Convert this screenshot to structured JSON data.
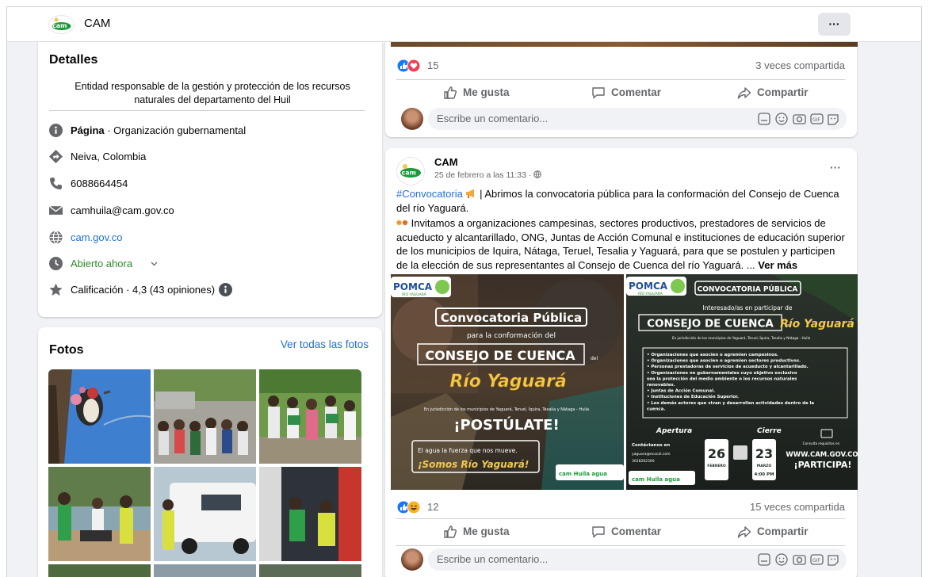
{
  "header": {
    "page_name": "CAM",
    "more_label": "···"
  },
  "details": {
    "title": "Detalles",
    "bio": "Entidad responsable de la gestión y protección de los recursos naturales del departamento del Huil",
    "category_label": "Página",
    "category_value": " · Organización gubernamental",
    "location": "Neiva, Colombia",
    "phone": "6088664454",
    "email": "camhuila@cam.gov.co",
    "website": "cam.gov.co",
    "hours": "Abierto ahora",
    "rating": "Calificación · 4,3 (43 opiniones)"
  },
  "photos": {
    "title": "Fotos",
    "see_all": "Ver todas las fotos"
  },
  "post_top": {
    "reaction_count": "15",
    "shares": "3 veces compartida",
    "like": "Me gusta",
    "comment": "Comentar",
    "share": "Compartir",
    "comment_placeholder": "Escribe un comentario..."
  },
  "post": {
    "author": "CAM",
    "timestamp": "25 de febrero a las 11:33 · ",
    "more_label": "···",
    "hashtag": "#Convocatoria",
    "text1": " | Abrimos la convocatoria pública para la conformación del Consejo de Cuenca del río Yaguará.",
    "text2": " Invitamos a organizaciones campesinas, sectores productivos, prestadores de servicios de acueducto y alcantarillado, ONG, Juntas de Acción Comunal e instituciones de educación superior de los municipios de Iquira, Nátaga, Teruel, Tesalia y Yaguará, para que se postulen y participen de la elección de sus representantes al Consejo de Cuenca del río Yaguará. ... ",
    "see_more": "Ver más",
    "reaction_count": "12",
    "shares": "15 veces compartida",
    "like": "Me gusta",
    "comment": "Comentar",
    "share": "Compartir",
    "comment_placeholder": "Escribe un comentario..."
  },
  "poster_left": {
    "logo": "POMCA",
    "logo_sub": "RÍO YAGUARÁ",
    "title": "Convocatoria Pública",
    "subtitle": "para la conformación del",
    "council": "CONSEJO DE CUENCA",
    "council_del": "del",
    "river": "Río Yaguará",
    "jurisdiction": "En jurisdicción de los municipios de Yaguará, Teruel, Íquira, Tesalia y Nátaga - Huila",
    "cta": "¡POSTÚLATE!",
    "slogan1": "El agua la fuerza que nos mueve.",
    "slogan2": "¡Somos Río Yaguará!",
    "footer": "cam  Huila  agua"
  },
  "poster_right": {
    "logo": "POMCA",
    "logo_sub": "RÍO YAGUARÁ",
    "badge": "CONVOCATORIA PÚBLICA",
    "interest": "Interesado/as en participar de",
    "council": "CONSEJO DE CUENCA",
    "council_del": "del",
    "river": "Río Yaguará",
    "jurisdiction": "En jurisdicción de los municipios de Yaguará, Teruel, Íquira, Tesalia y Nátaga - Huila",
    "list": [
      "• Organizaciones que asocien o agremien campesinos.",
      "• Organizaciones que asocien o agremien sectores productivos.",
      "• Personas prestadoras de servicios de acueducto y alcantarillado.",
      "• Organizaciones no gubernamentales cuyo objetivo exclusivo",
      "  sea la protección del medio ambiente o los recursos naturales",
      "  renovables.",
      "• Juntas de Acción Comunal.",
      "• Instituciones de Educación Superior.",
      "• Los demás actores que vivan y desarrollen actividades dentro de la",
      "  cuenca."
    ],
    "contact_title": "Contáctanos en",
    "contact_email": "yaguara@ecocol.com",
    "contact_phone": "3028262300",
    "apertura": "Apertura",
    "cierre": "Cierre",
    "open_day": "26",
    "open_month": "FEBRERO",
    "close_day": "23",
    "close_month": "MARZO",
    "close_time": "4:00 PM",
    "web_caption": "Consulta requisitos en",
    "web": "WWW.CAM.GOV.CO",
    "cta": "¡PARTICIPA!",
    "footer": "cam  Huila  agua"
  },
  "colors": {
    "link": "#216fdb",
    "open_green": "#2e8b2e",
    "icon_gray": "#65676b",
    "poster_dark": "#1f2b22",
    "poster_yellow": "#f2c94c",
    "poster_orange": "#f7941d"
  }
}
